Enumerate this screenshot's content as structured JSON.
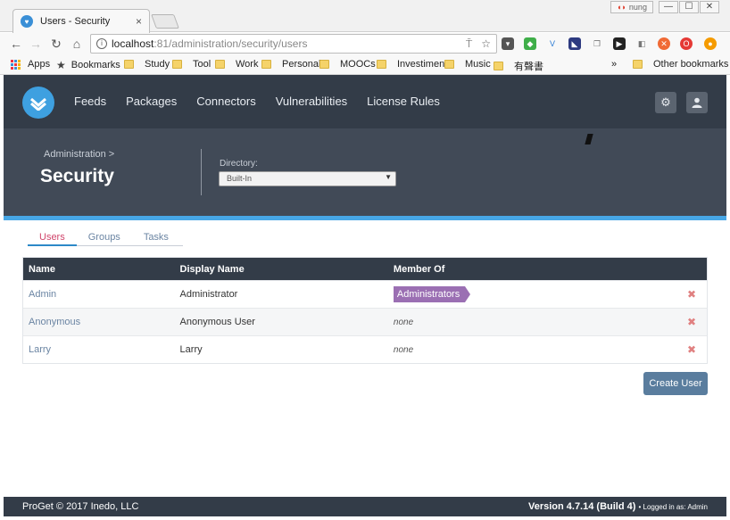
{
  "browser": {
    "tab_title": "Users - Security",
    "tab_close": "×",
    "profile_name": "nung",
    "url_host": "localhost",
    "url_path": ":81/administration/security/users",
    "window_buttons": [
      "—",
      "☐",
      "✕"
    ],
    "bookmarks": [
      {
        "label": "Apps",
        "icon": "apps-grid-icon"
      },
      {
        "label": "Bookmarks",
        "icon": "star-icon"
      },
      {
        "label": "Study",
        "icon": "folder-icon"
      },
      {
        "label": "Tool",
        "icon": "folder-icon"
      },
      {
        "label": "Work",
        "icon": "folder-icon"
      },
      {
        "label": "Personal",
        "icon": "folder-icon"
      },
      {
        "label": "MOOCs",
        "icon": "folder-icon"
      },
      {
        "label": "Investiment",
        "icon": "folder-icon"
      },
      {
        "label": "Music",
        "icon": "folder-icon"
      },
      {
        "label": "有聲書",
        "icon": "folder-icon"
      }
    ],
    "overflow": "»",
    "other_bookmarks": "Other bookmarks"
  },
  "nav": {
    "items": [
      "Feeds",
      "Packages",
      "Connectors",
      "Vulnerabilities",
      "License Rules"
    ]
  },
  "page": {
    "breadcrumb": "Administration >",
    "title": "Security",
    "directory_label": "Directory:",
    "directory_value": "Built-In"
  },
  "tabs": [
    "Users",
    "Groups",
    "Tasks"
  ],
  "table": {
    "headers": [
      "Name",
      "Display Name",
      "Member Of"
    ],
    "rows": [
      {
        "name": "Admin",
        "display": "Administrator",
        "member": "Administrators",
        "member_is_badge": true
      },
      {
        "name": "Anonymous",
        "display": "Anonymous User",
        "member": "none",
        "member_is_badge": false
      },
      {
        "name": "Larry",
        "display": "Larry",
        "member": "none",
        "member_is_badge": false
      }
    ],
    "delete_glyph": "✖"
  },
  "create_button": "Create User",
  "footer": {
    "copyright": "ProGet © 2017 Inedo, LLC",
    "version": "Version 4.7.14 (Build 4)",
    "logged_in": "• Logged in as: Admin"
  },
  "colors": {
    "header": "#333c48",
    "subheader": "#414a57",
    "accent": "#47a7e6",
    "badge": "#9b6fb3",
    "button": "#5a7d9e"
  }
}
